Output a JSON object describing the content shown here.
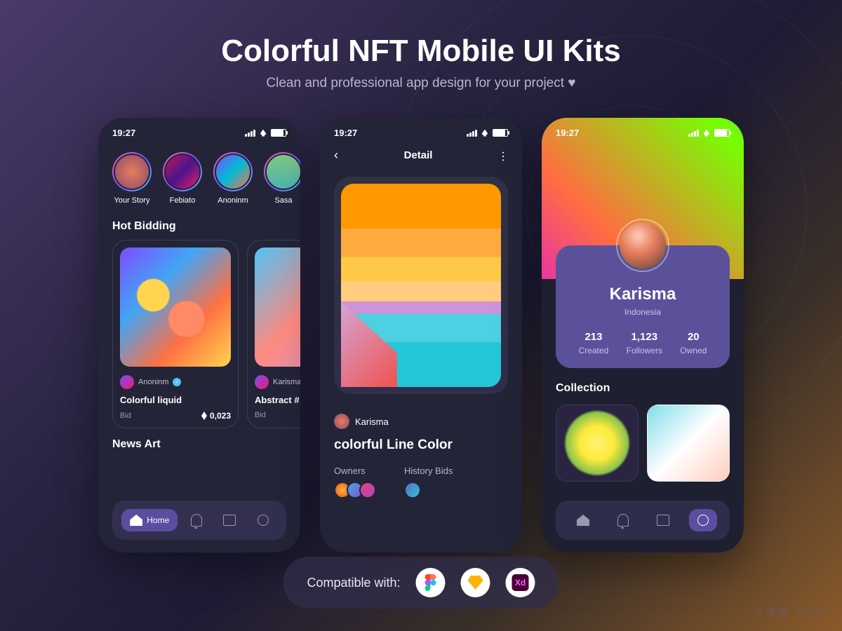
{
  "hero": {
    "title": "Colorful NFT Mobile UI Kits",
    "subtitle": "Clean and professional app design for your project ♥"
  },
  "status": {
    "time": "19:27"
  },
  "phone1": {
    "stories": [
      {
        "label": "Your Story"
      },
      {
        "label": "Febiato"
      },
      {
        "label": "Anoninm"
      },
      {
        "label": "Sasa"
      }
    ],
    "hot_bidding_title": "Hot Bidding",
    "cards": [
      {
        "author": "Anoninm",
        "title": "Colorful liquid",
        "bid_label": "Bid",
        "price": "0,023"
      },
      {
        "author": "Karisma",
        "title": "Abstract #",
        "bid_label": "Bid",
        "price": ""
      }
    ],
    "news_art_title": "News Art",
    "nav": {
      "home": "Home"
    }
  },
  "phone2": {
    "header_title": "Detail",
    "author": "Karisma",
    "item_title": "colorful Line Color",
    "tabs": {
      "owners": "Owners",
      "history": "History Bids"
    }
  },
  "phone3": {
    "profile": {
      "name": "Karisma",
      "location": "Indonesia",
      "stats": [
        {
          "value": "213",
          "label": "Created"
        },
        {
          "value": "1,123",
          "label": "Followers"
        },
        {
          "value": "20",
          "label": "Owned"
        }
      ]
    },
    "collection_title": "Collection"
  },
  "compat": {
    "label": "Compatible with:",
    "xd": "Xd"
  },
  "watermark": {
    "text": "ui",
    "cn": "老爹",
    "url": "ui8.com"
  }
}
